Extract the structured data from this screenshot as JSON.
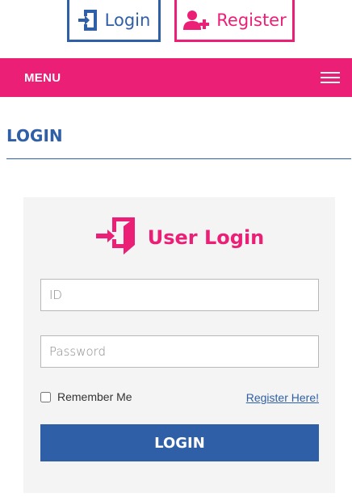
{
  "colors": {
    "primary_blue": "#2f5fa6",
    "accent_pink": "#ec1f76",
    "panel_bg": "#f4f4f4"
  },
  "top_nav": {
    "login": {
      "label": "Login",
      "icon": "door-enter-icon"
    },
    "register": {
      "label": "Register",
      "icon": "user-add-icon"
    }
  },
  "menu": {
    "label": "MENU",
    "icon": "hamburger-icon"
  },
  "page": {
    "title": "LOGIN"
  },
  "login_panel": {
    "title": "User Login",
    "icon": "door-enter-icon",
    "id_field": {
      "placeholder": "ID",
      "value": ""
    },
    "password_field": {
      "placeholder": "Password",
      "value": ""
    },
    "remember_label": "Remember Me",
    "remember_checked": false,
    "register_link": "Register Here!",
    "submit_label": "LOGIN"
  }
}
